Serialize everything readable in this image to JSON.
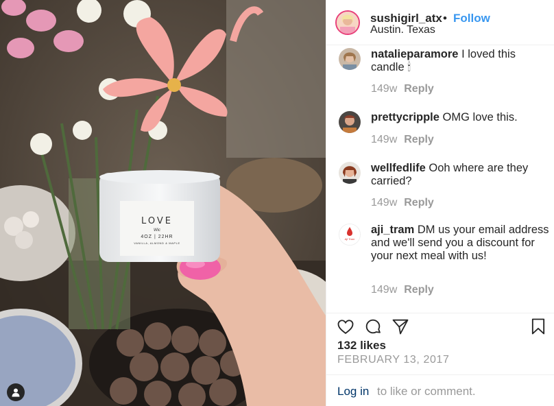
{
  "post": {
    "username": "sushigirl_atx",
    "separator": "•",
    "follow_label": "Follow",
    "location": "Austin. Texas"
  },
  "photo": {
    "candle_label": "LOVE",
    "candle_signature": "Wic",
    "candle_size": "4OZ | 22HR",
    "candle_scent": "VANILLA, ALMOND & MAPLE"
  },
  "comments": [
    {
      "username": "natalieparamore",
      "text": "I loved this candle 🕯",
      "time": "149w",
      "reply_label": "Reply"
    },
    {
      "username": "prettycripple",
      "text": "OMG love this.",
      "time": "149w",
      "reply_label": "Reply"
    },
    {
      "username": "wellfedlife",
      "text": "Ooh where are they carried?",
      "time": "149w",
      "reply_label": "Reply"
    },
    {
      "username": "aji_tram",
      "avatar_text": "Aji Tram",
      "text": "DM us your email address and we'll send you a discount for your next meal with us!",
      "time": "149w",
      "reply_label": "Reply"
    }
  ],
  "actions": {
    "like_icon": "heart-icon",
    "comment_icon": "comment-icon",
    "share_icon": "share-icon",
    "save_icon": "bookmark-icon"
  },
  "likes": "132 likes",
  "date": "FEBRUARY 13, 2017",
  "footer": {
    "login_label": "Log in",
    "login_suffix": "to like or comment."
  },
  "colors": {
    "link": "#3897f0",
    "text": "#262626",
    "muted": "#999999",
    "border": "#efefef"
  }
}
